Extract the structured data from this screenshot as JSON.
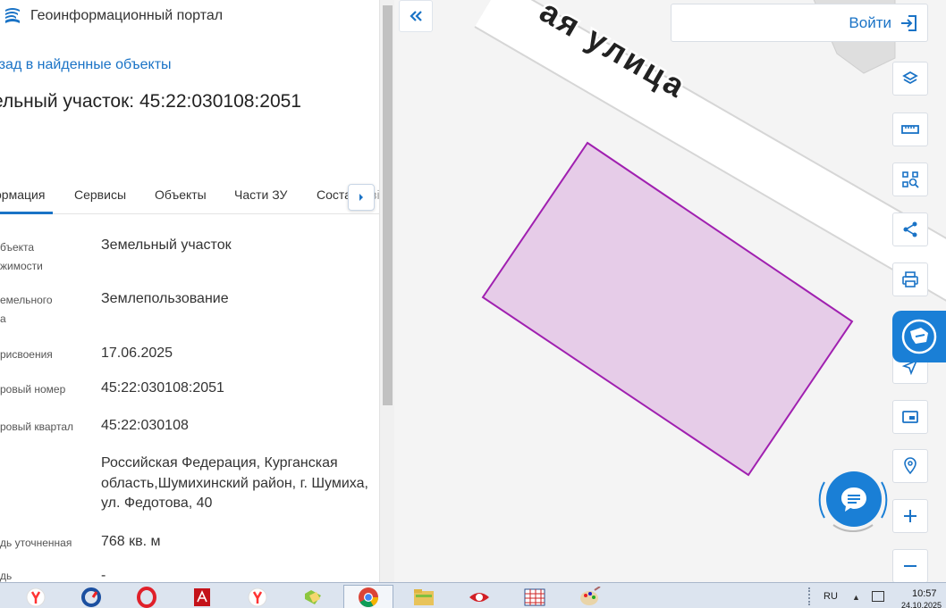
{
  "header": {
    "app_title": "Геоинформационный портал"
  },
  "nav": {
    "back_link": "азад в найденные объекты"
  },
  "object": {
    "title": "ельный участок: 45:22:030108:2051"
  },
  "tabs": [
    {
      "label": "ормация"
    },
    {
      "label": "Сервисы"
    },
    {
      "label": "Объекты"
    },
    {
      "label": "Части ЗУ"
    },
    {
      "label": "Соста"
    }
  ],
  "tab_overflow": "ві",
  "properties": [
    {
      "label_lines": [
        "бъекта",
        "жимости"
      ],
      "value": "Земельный участок"
    },
    {
      "label_lines": [
        "емельного",
        "а"
      ],
      "value": "Землепользование"
    },
    {
      "label_lines": [
        "рисвоения"
      ],
      "value": "17.06.2025"
    },
    {
      "label_lines": [
        "ровый номер"
      ],
      "value": "45:22:030108:2051"
    },
    {
      "label_lines": [
        "ровый квартал"
      ],
      "value": "45:22:030108"
    },
    {
      "label_lines": [],
      "value": "Российская Федерация, Курганская область,Шумихинский район, г. Шумиха, ул. Федотова, 40"
    },
    {
      "label_lines": [
        "дь уточненная"
      ],
      "value": "768 кв. м"
    },
    {
      "label_lines": [
        "дь"
      ],
      "value": "-"
    }
  ],
  "map": {
    "street_label": "ая улица",
    "parcel_fill": "#e6cce8",
    "parcel_stroke": "#a020b0"
  },
  "auth": {
    "login_label": "Войти"
  },
  "tools": {
    "layers": "layers-icon",
    "measure": "ruler-icon",
    "search_area": "area-search-icon",
    "share": "share-icon",
    "print": "print-icon",
    "locate": "location-arrow-icon",
    "minimap": "minimap-icon",
    "place": "place-search-icon",
    "zoom_in": "plus-icon",
    "zoom_out": "minus-icon"
  },
  "taskbar": {
    "language": "RU",
    "time": "10:57",
    "date": "24.10.2025",
    "apps": [
      "yandex-browser",
      "ccleaner",
      "opera",
      "acrobat",
      "yandex",
      "folder-green",
      "chrome",
      "file-explorer",
      "eye-app",
      "calendar-app",
      "paint"
    ]
  },
  "colors": {
    "accent": "#1a73c6",
    "accent_fill": "#1a7fd6",
    "panel_bg": "#ffffff",
    "map_bg": "#f4f4f4"
  }
}
